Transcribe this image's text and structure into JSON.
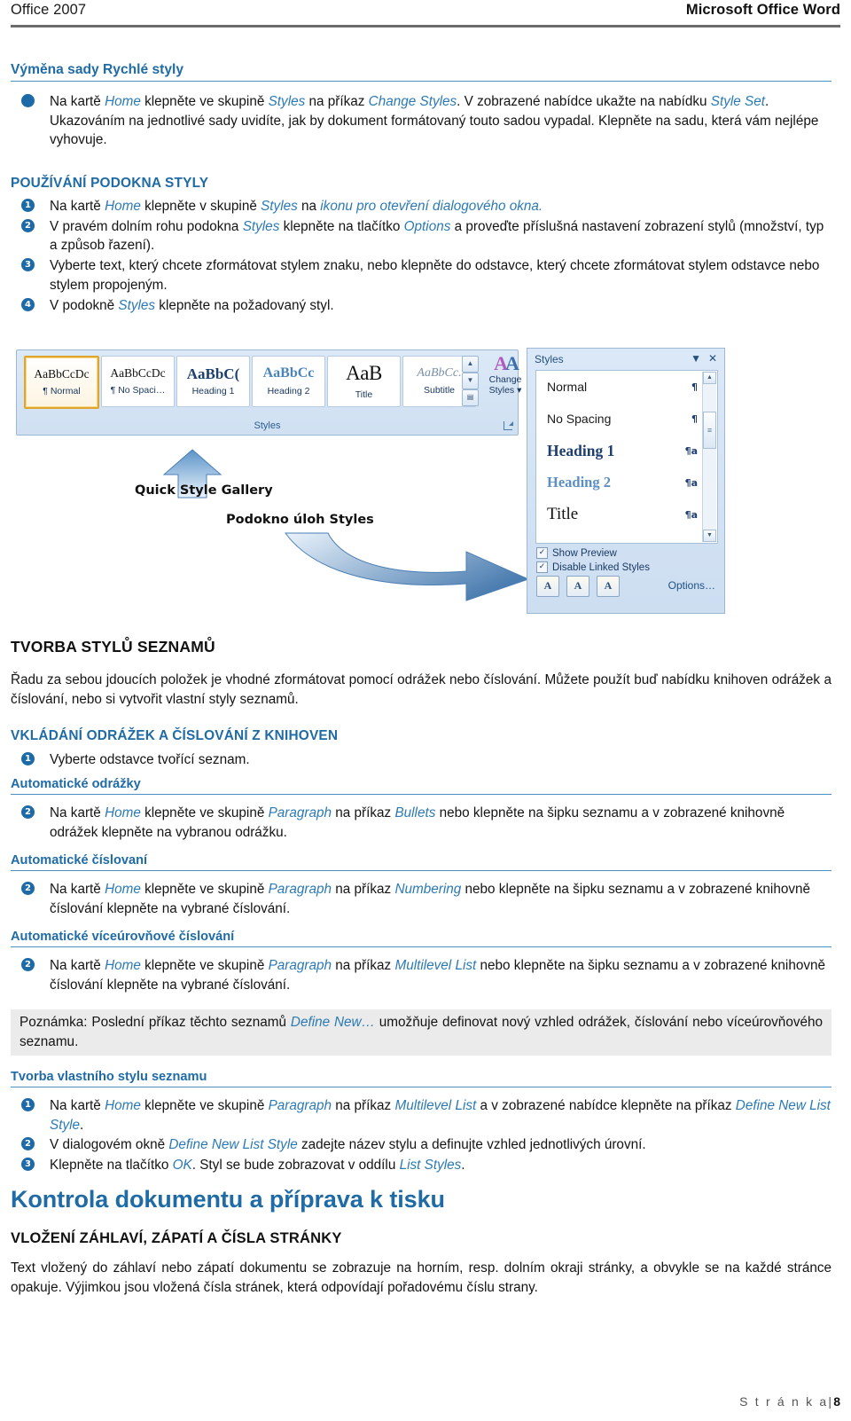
{
  "header": {
    "left": "Office 2007",
    "right": "Microsoft Office Word"
  },
  "sections": {
    "vymena": {
      "heading": "Výměna sady Rychlé styly",
      "bullet": {
        "marker": "●",
        "parts": [
          {
            "t": "Na kartě ",
            "s": "plain"
          },
          {
            "t": "Home",
            "s": "blue-i"
          },
          {
            "t": " klepněte ve skupině ",
            "s": "plain"
          },
          {
            "t": "Styles",
            "s": "blue-i"
          },
          {
            "t": " na příkaz ",
            "s": "plain"
          },
          {
            "t": "Change Styles",
            "s": "blue-i"
          },
          {
            "t": ". V zobrazené nabídce ukažte na nabídku ",
            "s": "plain"
          },
          {
            "t": "Style Set",
            "s": "blue-i"
          },
          {
            "t": ". Ukazováním na jednotlivé sady uvidíte, jak by dokument formátovaný touto sadou vypadal. Klepněte na sadu, která vám nejlépe vyhovuje.",
            "s": "plain"
          }
        ]
      }
    },
    "pouzivani": {
      "heading": "POUŽÍVÁNÍ PODOKNA STYLY",
      "items": [
        {
          "marker": "1",
          "parts": [
            {
              "t": "Na kartě ",
              "s": "plain"
            },
            {
              "t": "Home",
              "s": "blue-i"
            },
            {
              "t": " klepněte v skupině ",
              "s": "plain"
            },
            {
              "t": "Styles",
              "s": "blue-i"
            },
            {
              "t": " na ",
              "s": "plain"
            },
            {
              "t": "ikonu pro otevření dialogového okna.",
              "s": "blue-i"
            }
          ]
        },
        {
          "marker": "2",
          "parts": [
            {
              "t": "V pravém dolním rohu podokna ",
              "s": "plain"
            },
            {
              "t": "Styles",
              "s": "blue-i"
            },
            {
              "t": " klepněte na tlačítko ",
              "s": "plain"
            },
            {
              "t": "Options",
              "s": "blue-i"
            },
            {
              "t": " a proveďte příslušná nastavení zobrazení stylů (množství, typ a způsob řazení).",
              "s": "plain"
            }
          ]
        },
        {
          "marker": "3",
          "parts": [
            {
              "t": "Vyberte text, který chcete zformátovat stylem znaku, nebo klepněte do odstavce, který chcete zformátovat stylem odstavce nebo stylem propojeným.",
              "s": "plain"
            }
          ]
        },
        {
          "marker": "4",
          "parts": [
            {
              "t": "V podokně ",
              "s": "plain"
            },
            {
              "t": "Styles",
              "s": "blue-i"
            },
            {
              "t": " klepněte na požadovaný styl.",
              "s": "plain"
            }
          ]
        }
      ]
    },
    "tvorba": {
      "heading": "TVORBA STYLŮ SEZNAMŮ",
      "paragraph": "Řadu za sebou jdoucích položek je vhodné zformátovat pomocí odrážek nebo číslování. Můžete použít buď nabídku knihoven odrážek a číslování, nebo si vytvořit vlastní styly seznamů."
    },
    "vkladani": {
      "heading": "VKLÁDÁNÍ ODRÁŽEK A ČÍSLOVÁNÍ Z KNIHOVEN",
      "item1": {
        "marker": "1",
        "text": "Vyberte odstavce tvořící seznam."
      },
      "sub_odrazky": {
        "heading": "Automatické odrážky",
        "item": {
          "marker": "2",
          "parts": [
            {
              "t": "Na kartě ",
              "s": "plain"
            },
            {
              "t": "Home",
              "s": "blue-i"
            },
            {
              "t": " klepněte ve skupině ",
              "s": "plain"
            },
            {
              "t": "Paragraph",
              "s": "blue-i"
            },
            {
              "t": " na příkaz ",
              "s": "plain"
            },
            {
              "t": "Bullets",
              "s": "blue-i"
            },
            {
              "t": " nebo klepněte na šipku seznamu a v zobrazené knihovně odrážek klepněte na vybranou odrážku.",
              "s": "plain"
            }
          ]
        }
      },
      "sub_cislovani": {
        "heading": "Automatické číslovaní",
        "item": {
          "marker": "2",
          "parts": [
            {
              "t": "Na kartě ",
              "s": "plain"
            },
            {
              "t": "Home",
              "s": "blue-i"
            },
            {
              "t": " klepněte ve skupině ",
              "s": "plain"
            },
            {
              "t": "Paragraph",
              "s": "blue-i"
            },
            {
              "t": " na příkaz ",
              "s": "plain"
            },
            {
              "t": "Numbering",
              "s": "blue-i"
            },
            {
              "t": " nebo klepněte na šipku seznamu a v zobrazené knihovně číslování klepněte na vybrané číslování.",
              "s": "plain"
            }
          ]
        }
      },
      "sub_viceurovnove": {
        "heading": "Automatické víceúrovňové číslování",
        "item": {
          "marker": "2",
          "parts": [
            {
              "t": "Na kartě ",
              "s": "plain"
            },
            {
              "t": "Home",
              "s": "blue-i"
            },
            {
              "t": " klepněte ve skupině ",
              "s": "plain"
            },
            {
              "t": "Paragraph",
              "s": "blue-i"
            },
            {
              "t": " na příkaz ",
              "s": "plain"
            },
            {
              "t": "Multilevel List",
              "s": "blue-i"
            },
            {
              "t": " nebo klepněte na šipku seznamu a v zobrazené knihovně číslování klepněte na vybrané číslování.",
              "s": "plain"
            }
          ]
        }
      },
      "note": {
        "parts": [
          {
            "t": "Poznámka: Poslední příkaz těchto seznamů ",
            "s": "plain"
          },
          {
            "t": "Define New…",
            "s": "blue-i"
          },
          {
            "t": " umožňuje definovat nový vzhled odrážek, číslování nebo víceúrovňového seznamu.",
            "s": "plain"
          }
        ]
      }
    },
    "vlastni_styl": {
      "heading": "Tvorba vlastního stylu seznamu",
      "items": [
        {
          "marker": "1",
          "parts": [
            {
              "t": "Na kartě ",
              "s": "plain"
            },
            {
              "t": "Home",
              "s": "blue-i"
            },
            {
              "t": " klepněte ve skupině ",
              "s": "plain"
            },
            {
              "t": "Paragraph",
              "s": "blue-i"
            },
            {
              "t": " na příkaz ",
              "s": "plain"
            },
            {
              "t": "Multilevel List",
              "s": "blue-i"
            },
            {
              "t": " a v zobrazené nabídce klepněte na příkaz ",
              "s": "plain"
            },
            {
              "t": "Define New List Style",
              "s": "blue-i"
            },
            {
              "t": ".",
              "s": "plain"
            }
          ]
        },
        {
          "marker": "2",
          "parts": [
            {
              "t": "V dialogovém okně ",
              "s": "plain"
            },
            {
              "t": "Define New List Style",
              "s": "blue-i"
            },
            {
              "t": " zadejte název stylu a definujte vzhled jednotlivých úrovní.",
              "s": "plain"
            }
          ]
        },
        {
          "marker": "3",
          "parts": [
            {
              "t": "Klepněte na tlačítko ",
              "s": "plain"
            },
            {
              "t": "OK",
              "s": "blue-i"
            },
            {
              "t": ". Styl se bude zobrazovat v oddílu ",
              "s": "plain"
            },
            {
              "t": "List Styles",
              "s": "blue-i"
            },
            {
              "t": ".",
              "s": "plain"
            }
          ]
        }
      ]
    },
    "kontrola": {
      "heading": "Kontrola dokumentu a příprava k tisku",
      "sub_heading": "VLOŽENÍ ZÁHLAVÍ, ZÁPATÍ A ČÍSLA STRÁNKY",
      "paragraph": "Text vložený do záhlaví nebo zápatí dokumentu se zobrazuje na horním, resp. dolním okraji stránky, a obvykle se na každé stránce opakuje. Výjimkou jsou vložená čísla stránek, která odpovídají pořadovému číslu strany."
    }
  },
  "illustration": {
    "ribbon": {
      "group_label": "Styles",
      "gallery": [
        {
          "preview": "AaBbCcDc",
          "label": "¶ Normal",
          "selected": true
        },
        {
          "preview": "AaBbCcDc",
          "label": "¶ No Spaci…",
          "selected": false
        },
        {
          "preview": "AaBbC(",
          "label": "Heading 1",
          "selected": false
        },
        {
          "preview": "AaBbCc",
          "label": "Heading 2",
          "selected": false
        },
        {
          "preview": "AaB",
          "label": "Title",
          "selected": false
        },
        {
          "preview": "AaBbCc.",
          "label": "Subtitle",
          "selected": false
        }
      ],
      "change_styles_line1": "Change",
      "change_styles_line2": "Styles"
    },
    "callouts": {
      "quick_style_gallery": "Quick Style Gallery",
      "styles_task_pane": "Podokno úloh Styles"
    },
    "pane": {
      "title": "Styles",
      "styles": [
        {
          "name": "Normal",
          "mark": "¶"
        },
        {
          "name": "No Spacing",
          "mark": "¶"
        },
        {
          "name": "Heading 1",
          "mark": "¶a"
        },
        {
          "name": "Heading 2",
          "mark": "¶a"
        },
        {
          "name": "Title",
          "mark": "¶a"
        }
      ],
      "checkboxes": [
        {
          "label": "Show Preview",
          "checked": true
        },
        {
          "label": "Disable Linked Styles",
          "checked": true
        }
      ],
      "options_label": "Options…",
      "buttons": [
        "A",
        "A",
        "A"
      ]
    }
  },
  "footer": {
    "label": "S t r á n k a",
    "separator": "|",
    "number": "8"
  }
}
